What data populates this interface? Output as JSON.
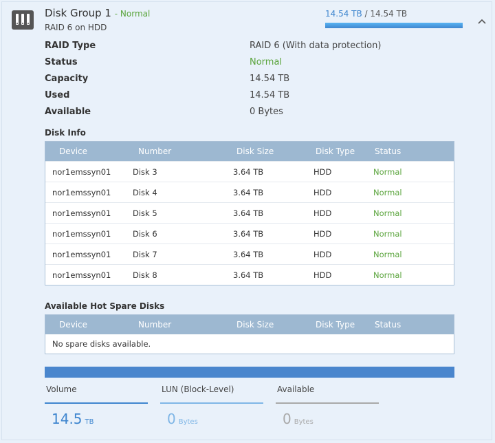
{
  "header": {
    "title": "Disk Group 1",
    "status_prefix": "- ",
    "status": "Normal",
    "subtitle": "RAID 6 on HDD",
    "used": "14.54 TB",
    "separator": " / ",
    "total": "14.54 TB",
    "usage_fraction": 1.0,
    "icons": {
      "group": "disk-group-icon",
      "collapse": "chevron-up-icon"
    }
  },
  "properties": [
    {
      "label": "RAID Type",
      "value": "RAID 6 (With data protection)",
      "ok": false
    },
    {
      "label": "Status",
      "value": "Normal",
      "ok": true
    },
    {
      "label": "Capacity",
      "value": "14.54 TB",
      "ok": false
    },
    {
      "label": "Used",
      "value": "14.54 TB",
      "ok": false
    },
    {
      "label": "Available",
      "value": "0 Bytes",
      "ok": false
    }
  ],
  "disk_info": {
    "title": "Disk Info",
    "columns": [
      "Device",
      "Number",
      "Disk Size",
      "Disk Type",
      "Status"
    ],
    "rows": [
      [
        "nor1emssyn01",
        "Disk 3",
        "3.64 TB",
        "HDD",
        "Normal"
      ],
      [
        "nor1emssyn01",
        "Disk 4",
        "3.64 TB",
        "HDD",
        "Normal"
      ],
      [
        "nor1emssyn01",
        "Disk 5",
        "3.64 TB",
        "HDD",
        "Normal"
      ],
      [
        "nor1emssyn01",
        "Disk 6",
        "3.64 TB",
        "HDD",
        "Normal"
      ],
      [
        "nor1emssyn01",
        "Disk 7",
        "3.64 TB",
        "HDD",
        "Normal"
      ],
      [
        "nor1emssyn01",
        "Disk 8",
        "3.64 TB",
        "HDD",
        "Normal"
      ]
    ]
  },
  "hot_spare": {
    "title": "Available Hot Spare Disks",
    "columns": [
      "Device",
      "Number",
      "Disk Size",
      "Disk Type",
      "Status"
    ],
    "empty_text": "No spare disks available."
  },
  "allocation": {
    "volume_fraction": 1.0,
    "stats": [
      {
        "label": "Volume",
        "value": "14.5",
        "unit": "TB",
        "color": "#3f86cf",
        "line_color": "#3f86cf"
      },
      {
        "label": "LUN (Block-Level)",
        "value": "0",
        "unit": "Bytes",
        "color": "#7fb6e6",
        "line_color": "#7fb6e6"
      },
      {
        "label": "Available",
        "value": "0",
        "unit": "Bytes",
        "color": "#a9a9a9",
        "line_color": "#a9a9a9"
      }
    ]
  },
  "colors": {
    "ok": "#5aa43c",
    "accent": "#3f86cf",
    "table_header": "#9db8d1"
  }
}
